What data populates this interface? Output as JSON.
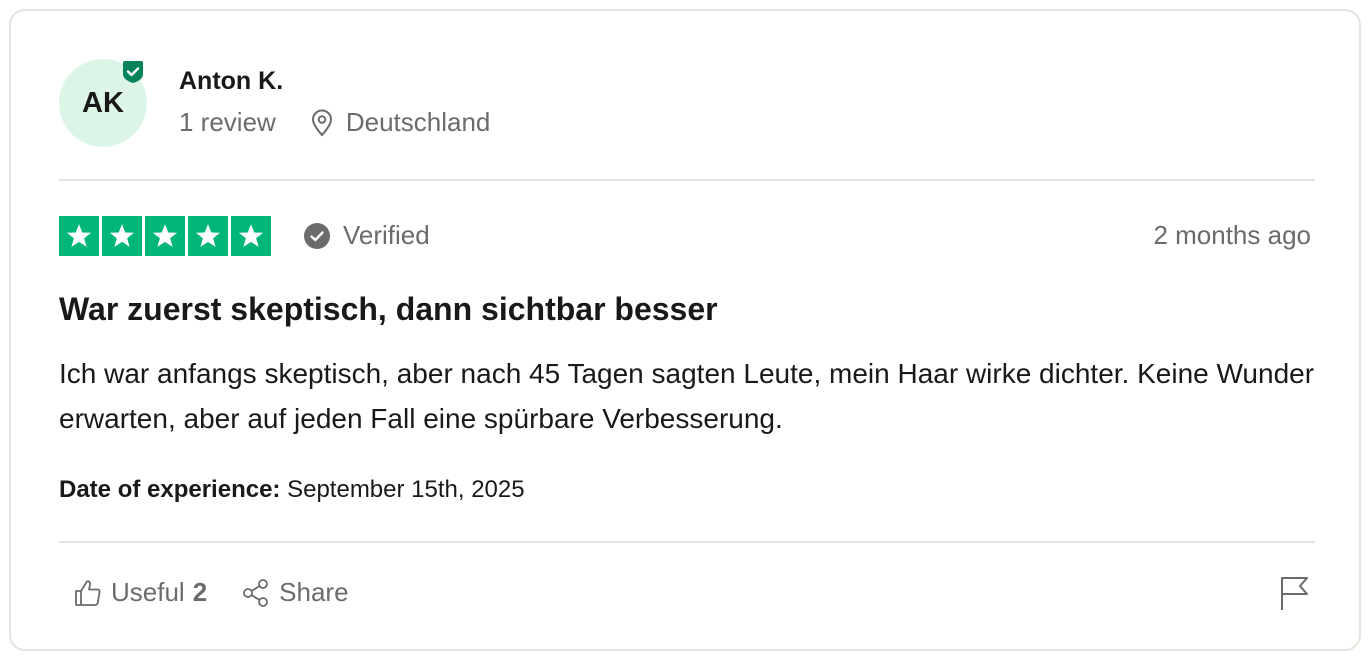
{
  "reviewer": {
    "initials": "AK",
    "name": "Anton K.",
    "reviews_count": "1 review",
    "location": "Deutschland"
  },
  "rating": {
    "stars": 5,
    "max_stars": 5,
    "verified_label": "Verified",
    "date_ago": "2 months ago"
  },
  "review": {
    "title": "War zuerst skeptisch, dann sichtbar besser",
    "body": "Ich war anfangs skeptisch, aber nach 45 Tagen sagten Leute, mein Haar wirke dichter. Keine Wunder erwarten, aber auf jeden Fall eine spürbare Verbesserung.",
    "experience_label": "Date of experience:",
    "experience_date": "September 15th, 2025"
  },
  "actions": {
    "useful_label": "Useful",
    "useful_count": "2",
    "share_label": "Share"
  },
  "colors": {
    "star_green": "#00b67a",
    "avatar_bg": "#dcf5e7",
    "badge_green": "#04825a",
    "muted_text": "#6b6b6b"
  },
  "icons": [
    "verified-badge-icon",
    "location-pin-icon",
    "star-icon",
    "check-circle-icon",
    "thumbs-up-icon",
    "share-icon",
    "flag-icon"
  ]
}
